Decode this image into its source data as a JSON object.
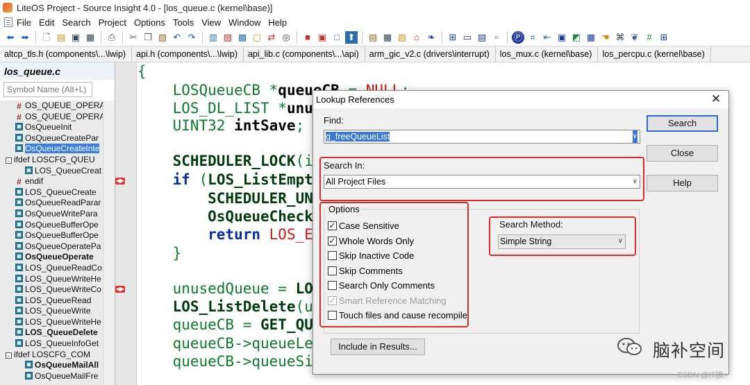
{
  "window": {
    "title": "LiteOS Project - Source Insight 4.0 - [los_queue.c (kernel\\base)]"
  },
  "menu": [
    "File",
    "Edit",
    "Search",
    "Project",
    "Options",
    "Tools",
    "View",
    "Window",
    "Help"
  ],
  "tabs": [
    "altcp_tls.h (components\\...\\lwip)",
    "api.h (components\\...\\lwip)",
    "api_lib.c (components\\...\\api)",
    "arm_gic_v2.c (drivers\\interrupt)",
    "los_mux.c (kernel\\base)",
    "los_percpu.c (kernel\\base)"
  ],
  "sidebar": {
    "file_name": "los_queue.c",
    "symbol_placeholder": "Symbol Name (Alt+L)",
    "symbols": [
      {
        "label": "OS_QUEUE_OPERAT",
        "icon": "hash-icon",
        "indent": 1
      },
      {
        "label": "OS_QUEUE_OPERAT",
        "icon": "hash-icon",
        "indent": 1
      },
      {
        "label": "OsQueueInit",
        "icon": "function-icon",
        "indent": 1
      },
      {
        "label": "OsQueueCreatePar",
        "icon": "function-icon",
        "indent": 1
      },
      {
        "label": "OsQueueCreateInte",
        "icon": "function-icon",
        "indent": 1,
        "selected": true
      },
      {
        "label": "ifdef LOSCFG_QUEU",
        "icon": "collapse-icon",
        "indent": 0
      },
      {
        "label": "LOS_QueueCreat",
        "icon": "function-icon",
        "indent": 2
      },
      {
        "label": "endif",
        "icon": "hash-icon",
        "indent": 1
      },
      {
        "label": "LOS_QueueCreate",
        "icon": "function-icon",
        "indent": 1
      },
      {
        "label": "OsQueueReadParar",
        "icon": "function-icon",
        "indent": 1
      },
      {
        "label": "OsQueueWritePara",
        "icon": "function-icon",
        "indent": 1
      },
      {
        "label": "OsQueueBufferOpe",
        "icon": "function-icon",
        "indent": 1
      },
      {
        "label": "OsQueueBufferOpe",
        "icon": "function-icon",
        "indent": 1
      },
      {
        "label": "OsQueueOperatePa",
        "icon": "function-icon",
        "indent": 1
      },
      {
        "label": "OsQueueOperate",
        "icon": "function-icon",
        "indent": 1,
        "bold": true
      },
      {
        "label": "LOS_QueueReadCo",
        "icon": "function-icon",
        "indent": 1
      },
      {
        "label": "LOS_QueueWriteHe",
        "icon": "function-icon",
        "indent": 1
      },
      {
        "label": "LOS_QueueWriteCo",
        "icon": "function-icon",
        "indent": 1
      },
      {
        "label": "LOS_QueueRead",
        "icon": "function-icon",
        "indent": 1
      },
      {
        "label": "LOS_QueueWrite",
        "icon": "function-icon",
        "indent": 1
      },
      {
        "label": "LOS_QueueWriteHe",
        "icon": "function-icon",
        "indent": 1
      },
      {
        "label": "LOS_QueueDelete",
        "icon": "function-icon",
        "indent": 1,
        "bold": true
      },
      {
        "label": "LOS_QueueInfoGet",
        "icon": "function-icon",
        "indent": 1
      },
      {
        "label": "ifdef LOSCFG_COM",
        "icon": "collapse-icon",
        "indent": 0
      },
      {
        "label": "OsQueueMailAll",
        "icon": "function-icon",
        "indent": 2,
        "bold": true
      },
      {
        "label": "OsQueueMailFre",
        "icon": "function-icon",
        "indent": 2
      }
    ]
  },
  "code": {
    "lines": [
      {
        "parts": [
          {
            "t": "{",
            "c": ""
          }
        ]
      },
      {
        "parts": [
          {
            "t": "    LOSQueueCB *",
            "c": ""
          },
          {
            "t": "queueCB",
            "c": "b"
          },
          {
            "t": " = ",
            "c": ""
          },
          {
            "t": "NULL",
            "c": "red"
          },
          {
            "t": ";",
            "c": ""
          }
        ]
      },
      {
        "parts": [
          {
            "t": "    LOS_DL_LIST *",
            "c": ""
          },
          {
            "t": "unu",
            "c": "b"
          }
        ]
      },
      {
        "parts": [
          {
            "t": "    UINT32 ",
            "c": ""
          },
          {
            "t": "intSave",
            "c": "b"
          },
          {
            "t": ";",
            "c": ""
          }
        ]
      },
      {
        "parts": [
          {
            "t": "",
            "c": ""
          }
        ]
      },
      {
        "parts": [
          {
            "t": "    SCHEDULER_LOCK",
            "c": "dark"
          },
          {
            "t": "(i",
            "c": ""
          }
        ]
      },
      {
        "parts": [
          {
            "t": "    ",
            "c": ""
          },
          {
            "t": "if",
            "c": "kw"
          },
          {
            "t": " (",
            "c": ""
          },
          {
            "t": "LOS_ListEmpt",
            "c": "dark"
          }
        ]
      },
      {
        "parts": [
          {
            "t": "        SCHEDULER_UN",
            "c": "dark"
          }
        ]
      },
      {
        "parts": [
          {
            "t": "        OsQueueCheck",
            "c": "dark"
          }
        ]
      },
      {
        "parts": [
          {
            "t": "        ",
            "c": ""
          },
          {
            "t": "return",
            "c": "kw"
          },
          {
            "t": " LOS_E",
            "c": "red"
          }
        ]
      },
      {
        "parts": [
          {
            "t": "    }",
            "c": ""
          }
        ]
      },
      {
        "parts": [
          {
            "t": "",
            "c": ""
          }
        ]
      },
      {
        "parts": [
          {
            "t": "    unusedQueue = ",
            "c": ""
          },
          {
            "t": "LO",
            "c": "dark"
          }
        ]
      },
      {
        "parts": [
          {
            "t": "    LOS_ListDelete",
            "c": "dark"
          },
          {
            "t": "(u",
            "c": ""
          }
        ]
      },
      {
        "parts": [
          {
            "t": "    queueCB = ",
            "c": ""
          },
          {
            "t": "GET_QU",
            "c": "dark"
          }
        ]
      },
      {
        "parts": [
          {
            "t": "    queueCB->queueLe",
            "c": ""
          }
        ]
      },
      {
        "parts": [
          {
            "t": "    queueCB->queueSi",
            "c": ""
          }
        ]
      }
    ]
  },
  "dialog": {
    "title": "Lookup References",
    "find_label": "Find:",
    "find_value": "g_freeQueueList",
    "search_in_label": "Search In:",
    "search_in_value": "All Project Files",
    "options_label": "Options",
    "options": [
      {
        "label": "Case Sensitive",
        "checked": true,
        "disabled": false
      },
      {
        "label": "Whole Words Only",
        "checked": true,
        "disabled": false
      },
      {
        "label": "Skip Inactive Code",
        "checked": false,
        "disabled": false
      },
      {
        "label": "Skip Comments",
        "checked": false,
        "disabled": false
      },
      {
        "label": "Search Only Comments",
        "checked": false,
        "disabled": false
      },
      {
        "label": "Smart Reference Matching",
        "checked": true,
        "disabled": true
      },
      {
        "label": "Touch files and cause recompile",
        "checked": false,
        "disabled": false
      }
    ],
    "search_method_label": "Search Method:",
    "search_method_value": "Simple String",
    "buttons": {
      "search": "Search",
      "close": "Close",
      "help": "Help",
      "include": "Include in Results..."
    },
    "close_glyph": "✕"
  },
  "watermark": {
    "text": "脑补空间",
    "small": "CSDN @IT狼~"
  },
  "colors": {
    "highlight": "#e02a2a",
    "selection": "#3a78d6",
    "code_green": "#0c7a2c"
  }
}
